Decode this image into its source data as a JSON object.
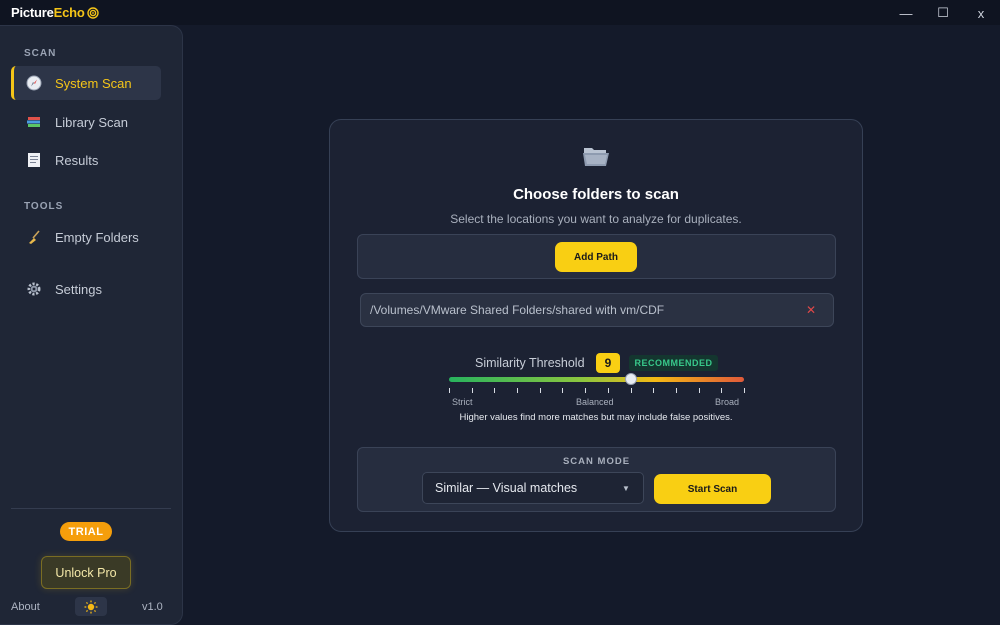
{
  "app": {
    "title_main": "Picture",
    "title_accent": "Echo",
    "logo_icon": "wifi-icon",
    "window_controls": {
      "minimize": "—",
      "maximize": "☐",
      "close": "x"
    }
  },
  "colors": {
    "accent": "#f5c518",
    "background": "#141a2a",
    "panel": "#1c2233",
    "danger": "#e04848",
    "success": "#38c98a"
  },
  "sidebar": {
    "scan_label": "SCAN",
    "tools_label": "TOOLS",
    "items": [
      {
        "label": "System Scan",
        "icon": "compass-icon",
        "active": true
      },
      {
        "label": "Library Scan",
        "icon": "books-icon",
        "active": false
      },
      {
        "label": "Results",
        "icon": "receipt-icon",
        "active": false
      },
      {
        "label": "Empty Folders",
        "icon": "broom-icon",
        "active": false
      },
      {
        "label": "Settings",
        "icon": "gear-icon",
        "active": false
      }
    ],
    "trial_badge": "TRIAL",
    "unlock_label": "Unlock Pro",
    "about_label": "About",
    "theme_icon": "sun-icon",
    "version": "v1.0"
  },
  "main": {
    "folder_icon": "open-folder-icon",
    "title": "Choose folders to scan",
    "subtitle": "Select the locations you want to analyze for duplicates.",
    "add_path_label": "Add Path",
    "paths": [
      "/Volumes/VMware Shared Folders/shared with vm/CDF"
    ],
    "remove_icon_glyph": "✕",
    "threshold": {
      "label": "Similarity Threshold",
      "value": "9",
      "min": 1,
      "max": 14,
      "level": 9,
      "badge": "RECOMMENDED",
      "scale_strict": "Strict",
      "scale_balanced": "Balanced",
      "scale_broad": "Broad",
      "help": "Higher values find more matches but may include false positives."
    },
    "scan_mode": {
      "label": "SCAN MODE",
      "selected": "Similar — Visual matches",
      "start_label": "Start Scan"
    }
  }
}
